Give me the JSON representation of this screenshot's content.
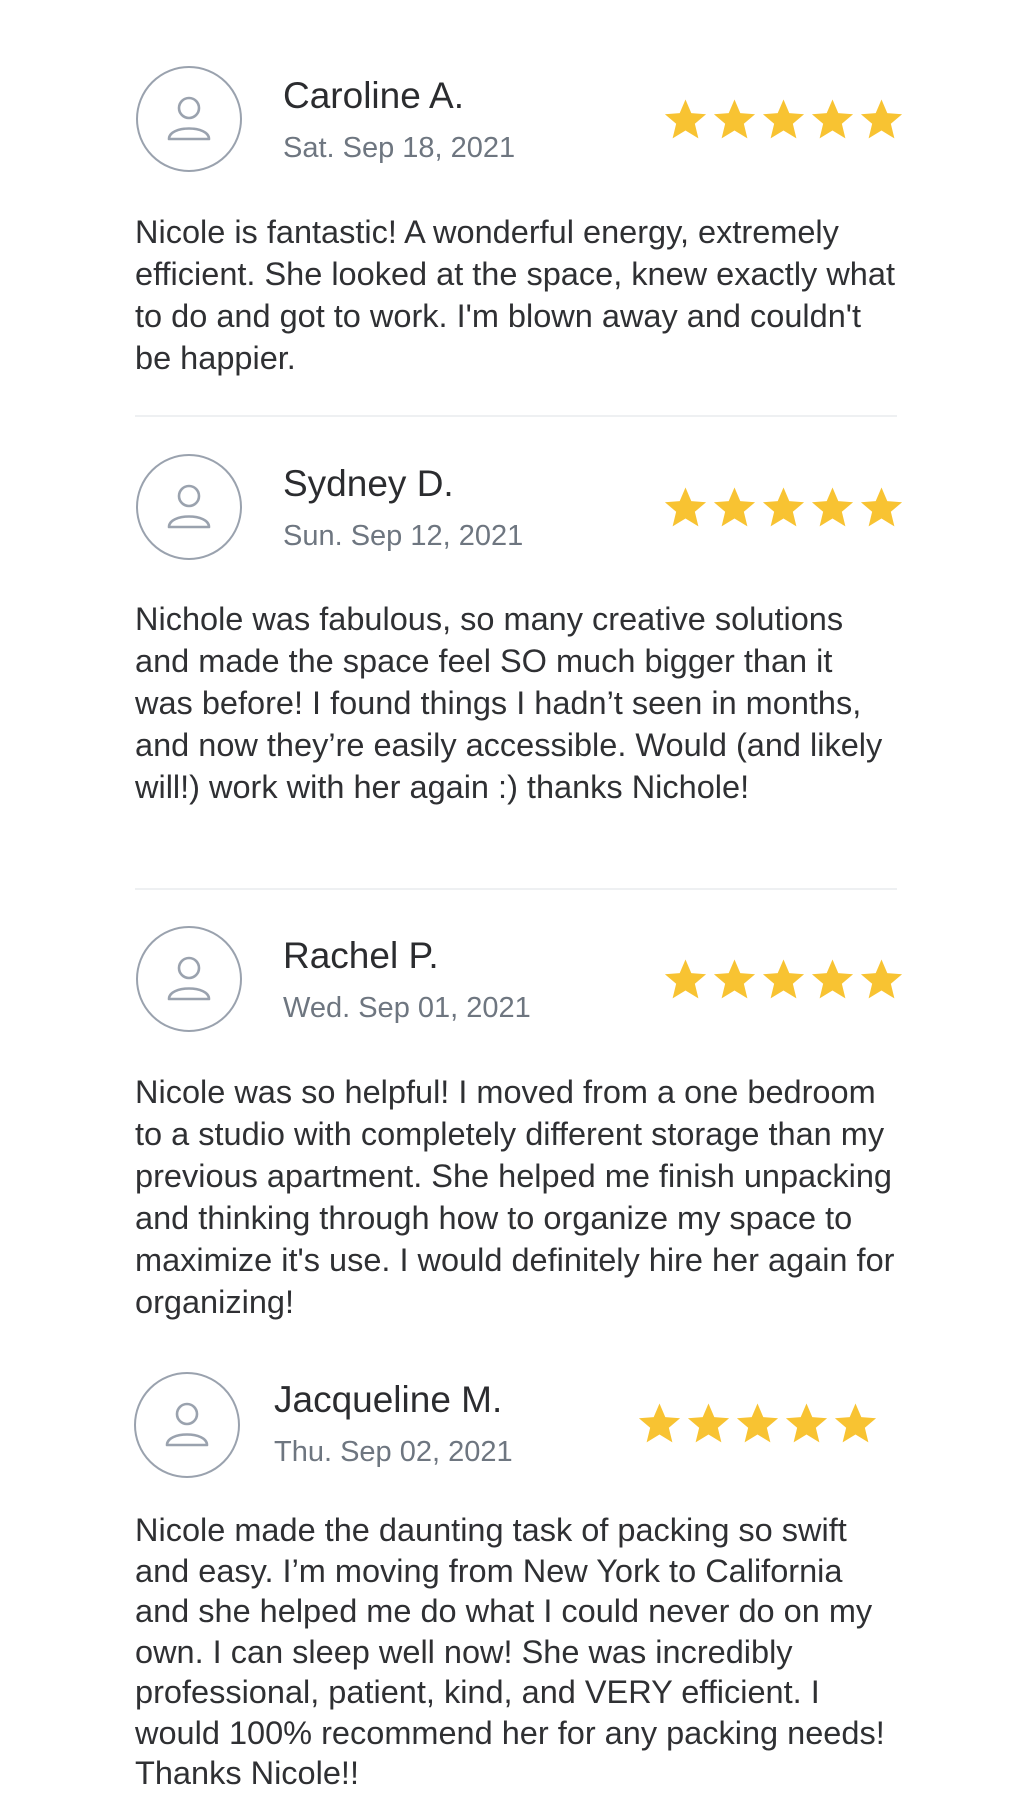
{
  "reviews": [
    {
      "name": "Caroline A.",
      "date": "Sat. Sep 18, 2021",
      "rating": 5,
      "text": "Nicole is fantastic! A wonderful energy, extremely efficient. She looked at the space, knew exactly what to do and got to work. I'm blown away and couldn't be happier."
    },
    {
      "name": "Sydney D.",
      "date": "Sun. Sep 12, 2021",
      "rating": 5,
      "text": "Nichole was fabulous, so many creative solutions and made the space feel SO much bigger than it was before! I found things I hadn’t seen in months, and now they’re easily accessible. Would (and likely will!) work with her again :) thanks Nichole!"
    },
    {
      "name": "Rachel P.",
      "date": "Wed. Sep 01, 2021",
      "rating": 5,
      "text": "Nicole was so helpful! I moved from a one bedroom to a studio with completely different storage than my previous apartment. She helped me finish unpacking and thinking through how to organize my space to maximize it's use. I would definitely hire her again for organizing!"
    },
    {
      "name": "Jacqueline M.",
      "date": "Thu. Sep 02, 2021",
      "rating": 5,
      "text": "Nicole made the daunting task of packing so swift and easy. I’m moving from New York to California and she helped me do what I could never do on my own. I can sleep well now! She was incredibly professional, patient, kind, and VERY efficient. I would 100% recommend her for any packing needs! Thanks Nicole!!"
    }
  ],
  "colors": {
    "star": "#f8c332",
    "avatar_border": "#9aa2ae",
    "name": "#2b2c2f",
    "date": "#6e7680",
    "text": "#2f3033"
  },
  "icons": {
    "avatar": "user-icon",
    "rating": "star-icon"
  }
}
